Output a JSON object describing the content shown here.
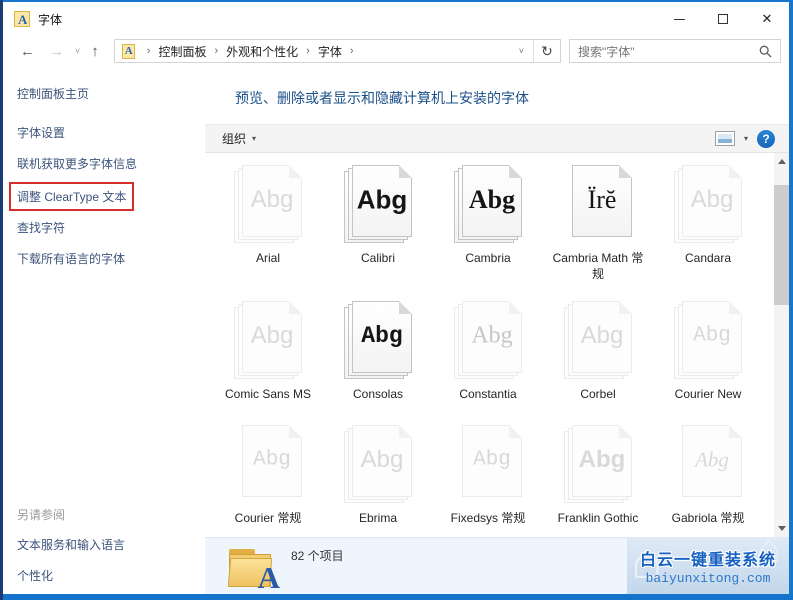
{
  "window": {
    "title": "字体",
    "icon_letter": "A",
    "close_glyph": "✕"
  },
  "nav": {
    "back_glyph": "←",
    "forward_glyph": "→",
    "chevron_glyph": "˅",
    "up_glyph": "↑",
    "refresh_glyph": "↻",
    "sep": "›",
    "breadcrumb": [
      {
        "label": "控制面板"
      },
      {
        "label": "外观和个性化"
      },
      {
        "label": "字体"
      }
    ],
    "search_placeholder": "搜索\"字体\""
  },
  "sidebar": {
    "home": "控制面板主页",
    "tasks": [
      {
        "label": "字体设置"
      },
      {
        "label": "联机获取更多字体信息"
      },
      {
        "label": "调整 ClearType 文本",
        "state": "highlighted"
      },
      {
        "label": "查找字符"
      },
      {
        "label": "下载所有语言的字体"
      }
    ],
    "see_also_header": "另请参阅",
    "see_also": [
      {
        "label": "文本服务和输入语言"
      },
      {
        "label": "个性化"
      }
    ]
  },
  "main": {
    "header": "预览、删除或者显示和隐藏计算机上安装的字体",
    "toolbar": {
      "organize": "组织",
      "caret": "▾",
      "help": "?"
    },
    "fonts": [
      {
        "name": "Arial",
        "glyph": "Abg",
        "icon": "stack",
        "tone": "light",
        "face": "sans"
      },
      {
        "name": "Calibri",
        "glyph": "Abg",
        "icon": "stack",
        "tone": "dark",
        "face": "sans",
        "weight": "bold"
      },
      {
        "name": "Cambria",
        "glyph": "Abg",
        "icon": "stack",
        "tone": "dark",
        "face": "serif",
        "weight": "bold"
      },
      {
        "name": "Cambria Math 常规",
        "glyph": "Ïrĕ",
        "icon": "single",
        "tone": "dark",
        "face": "serif"
      },
      {
        "name": "Candara",
        "glyph": "Abg",
        "icon": "stack",
        "tone": "light",
        "face": "sans"
      },
      {
        "name": "Comic Sans MS",
        "glyph": "Abg",
        "icon": "stack",
        "tone": "light",
        "face": "sans"
      },
      {
        "name": "Consolas",
        "glyph": "Abg",
        "icon": "stack",
        "tone": "dark",
        "face": "mono",
        "weight": "bold"
      },
      {
        "name": "Constantia",
        "glyph": "Abg",
        "icon": "stack",
        "tone": "medium",
        "face": "serif"
      },
      {
        "name": "Corbel",
        "glyph": "Abg",
        "icon": "stack",
        "tone": "light",
        "face": "sans"
      },
      {
        "name": "Courier New",
        "glyph": "Abg",
        "icon": "stack",
        "tone": "light",
        "face": "mono"
      },
      {
        "name": "Courier 常规",
        "glyph": "Abg",
        "icon": "single",
        "tone": "light",
        "face": "mono"
      },
      {
        "name": "Ebrima",
        "glyph": "Abg",
        "icon": "stack",
        "tone": "light",
        "face": "sans"
      },
      {
        "name": "Fixedsys 常规",
        "glyph": "Abg",
        "icon": "single",
        "tone": "light",
        "face": "mono"
      },
      {
        "name": "Franklin Gothic",
        "glyph": "Abg",
        "icon": "stack",
        "tone": "light",
        "face": "sans",
        "weight": "bold"
      },
      {
        "name": "Gabriola 常规",
        "glyph": "Abg",
        "icon": "single",
        "tone": "light",
        "face": "script"
      }
    ],
    "status": {
      "count_label": "82 个项目",
      "folder_letter": "A"
    }
  },
  "watermark": {
    "line1": "白云一键重装系统",
    "line2": "baiyunxitong.com",
    "house_glyph": "⌂"
  },
  "colors": {
    "accent_border": "#1577cf",
    "left_border": "#1b3d74",
    "link_blue": "#3c547c",
    "header_blue": "#1b5088",
    "highlight_red": "#d43029",
    "help_blue": "#1366b8",
    "watermark_blue": "#1761c2"
  }
}
